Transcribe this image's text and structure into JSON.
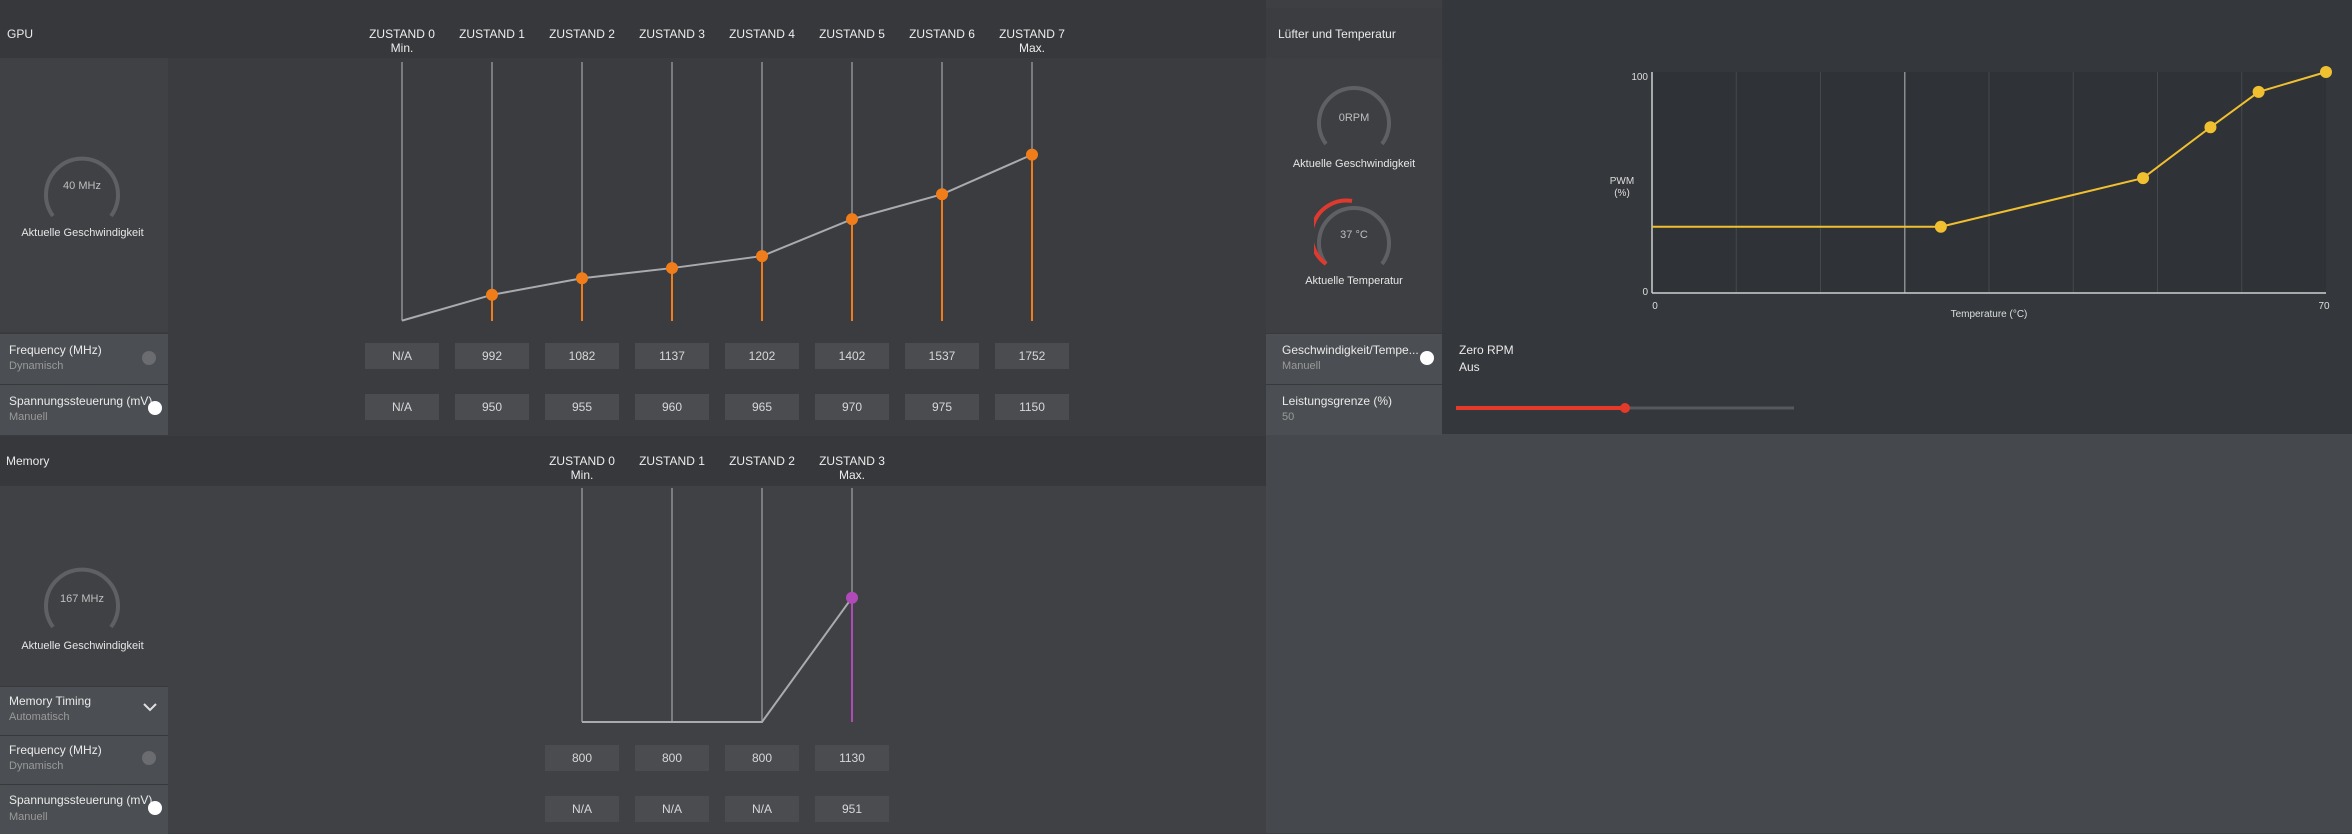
{
  "gpu": {
    "title": "GPU",
    "states": [
      "ZUSTAND 0 Min.",
      "ZUSTAND 1",
      "ZUSTAND 2",
      "ZUSTAND 3",
      "ZUSTAND 4",
      "ZUSTAND 5",
      "ZUSTAND 6",
      "ZUSTAND 7 Max."
    ],
    "gauge_value": "40 MHz",
    "gauge_label": "Aktuelle Geschwindigkeit",
    "frequency_label": "Frequency (MHz)",
    "frequency_mode": "Dynamisch",
    "voltage_label": "Spannungssteuerung (mV)",
    "voltage_mode": "Manuell",
    "frequencies": [
      "N/A",
      "992",
      "1082",
      "1137",
      "1202",
      "1402",
      "1537",
      "1752"
    ],
    "voltages": [
      "N/A",
      "950",
      "955",
      "960",
      "965",
      "970",
      "975",
      "1150"
    ],
    "accent": "#f07d1a"
  },
  "memory": {
    "title": "Memory",
    "states": [
      "ZUSTAND 0 Min.",
      "ZUSTAND 1",
      "ZUSTAND 2",
      "ZUSTAND 3 Max."
    ],
    "gauge_value": "167 MHz",
    "gauge_label": "Aktuelle Geschwindigkeit",
    "timing_label": "Memory Timing",
    "timing_mode": "Automatisch",
    "frequency_label": "Frequency (MHz)",
    "frequency_mode": "Dynamisch",
    "voltage_label": "Spannungssteuerung (mV)",
    "voltage_mode": "Manuell",
    "frequencies": [
      "800",
      "800",
      "800",
      "1130"
    ],
    "voltages": [
      "N/A",
      "N/A",
      "N/A",
      "951"
    ],
    "accent": "#b04ab8"
  },
  "fan": {
    "title": "Lüfter und Temperatur",
    "speed_value": "0RPM",
    "speed_label": "Aktuelle Geschwindigkeit",
    "temp_value": "37 °C",
    "temp_label": "Aktuelle Temperatur",
    "control_label": "Geschwindigkeit/Tempe...",
    "control_mode": "Manuell",
    "zero_rpm_label": "Zero RPM",
    "zero_rpm_value": "Aus",
    "power_limit_label": "Leistungsgrenze (%)",
    "power_limit_value": "50",
    "power_limit_fraction": 0.5,
    "accent": "#f0c030",
    "slider_color": "#e53a2a"
  },
  "chart_data": [
    {
      "type": "line",
      "categories": [
        "ZUSTAND 0 Min.",
        "ZUSTAND 1",
        "ZUSTAND 2",
        "ZUSTAND 3",
        "ZUSTAND 4",
        "ZUSTAND 5",
        "ZUSTAND 6",
        "ZUSTAND 7 Max."
      ],
      "values": [
        852,
        992,
        1082,
        1137,
        1202,
        1402,
        1537,
        1752
      ],
      "ylim": [
        850,
        2200
      ]
    },
    {
      "type": "line",
      "categories": [
        "ZUSTAND 0 Min.",
        "ZUSTAND 1",
        "ZUSTAND 2",
        "ZUSTAND 3 Max."
      ],
      "values": [
        800,
        800,
        800,
        1130
      ],
      "ylim": [
        800,
        1400
      ]
    },
    {
      "type": "line",
      "xlabel": "Temperature (°C)",
      "ylabel": "PWM\n(%)",
      "x_ticks": [
        "0",
        "70"
      ],
      "y_ticks": [
        "100",
        "0"
      ],
      "xlim": [
        0,
        70
      ],
      "ylim": [
        0,
        100
      ],
      "x": [
        0,
        30,
        51,
        58,
        63,
        70
      ],
      "y": [
        30,
        30,
        52,
        75,
        91,
        100
      ]
    }
  ]
}
